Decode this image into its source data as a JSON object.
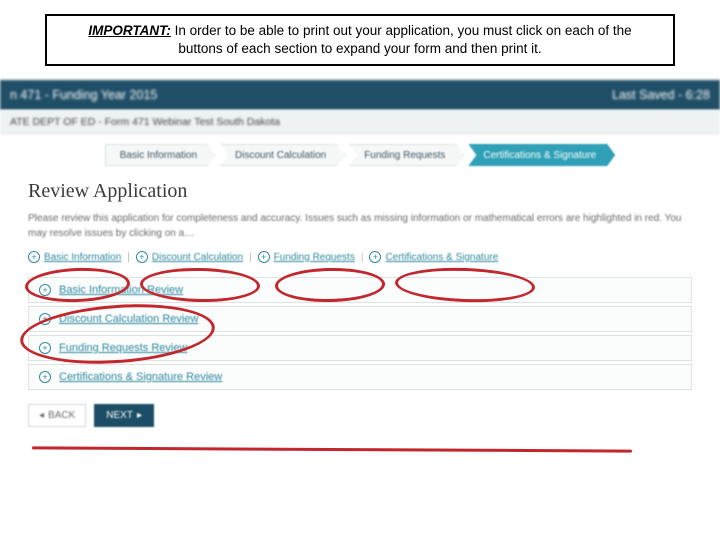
{
  "callout": {
    "important_label": "IMPORTANT:",
    "text": "In order to be able to print out your application, you must click on each of the buttons of each section to expand your form and then print it."
  },
  "header": {
    "title": "n 471 - Funding Year 2015",
    "saved": "Last Saved - 6:28"
  },
  "breadcrumb": "ATE DEPT OF ED - Form 471 Webinar Test South Dakota",
  "steps": [
    {
      "label": "Basic Information",
      "active": false
    },
    {
      "label": "Discount Calculation",
      "active": false
    },
    {
      "label": "Funding Requests",
      "active": false
    },
    {
      "label": "Certifications & Signature",
      "active": true
    }
  ],
  "review": {
    "heading": "Review Application",
    "description": "Please review this application for completeness and accuracy. Issues such as missing information or mathematical errors are highlighted in red. You may resolve issues by clicking on a…"
  },
  "quicklinks": [
    {
      "label": "Basic Information"
    },
    {
      "label": "Discount Calculation"
    },
    {
      "label": "Funding Requests"
    },
    {
      "label": "Certifications & Signature"
    }
  ],
  "panels": [
    {
      "label": "Basic Information Review"
    },
    {
      "label": "Discount Calculation Review"
    },
    {
      "label": "Funding Requests Review"
    },
    {
      "label": "Certifications & Signature Review"
    }
  ],
  "buttons": {
    "back": "BACK",
    "next": "NEXT"
  },
  "icons": {
    "plus": "+",
    "left": "◂",
    "right": "▸"
  }
}
